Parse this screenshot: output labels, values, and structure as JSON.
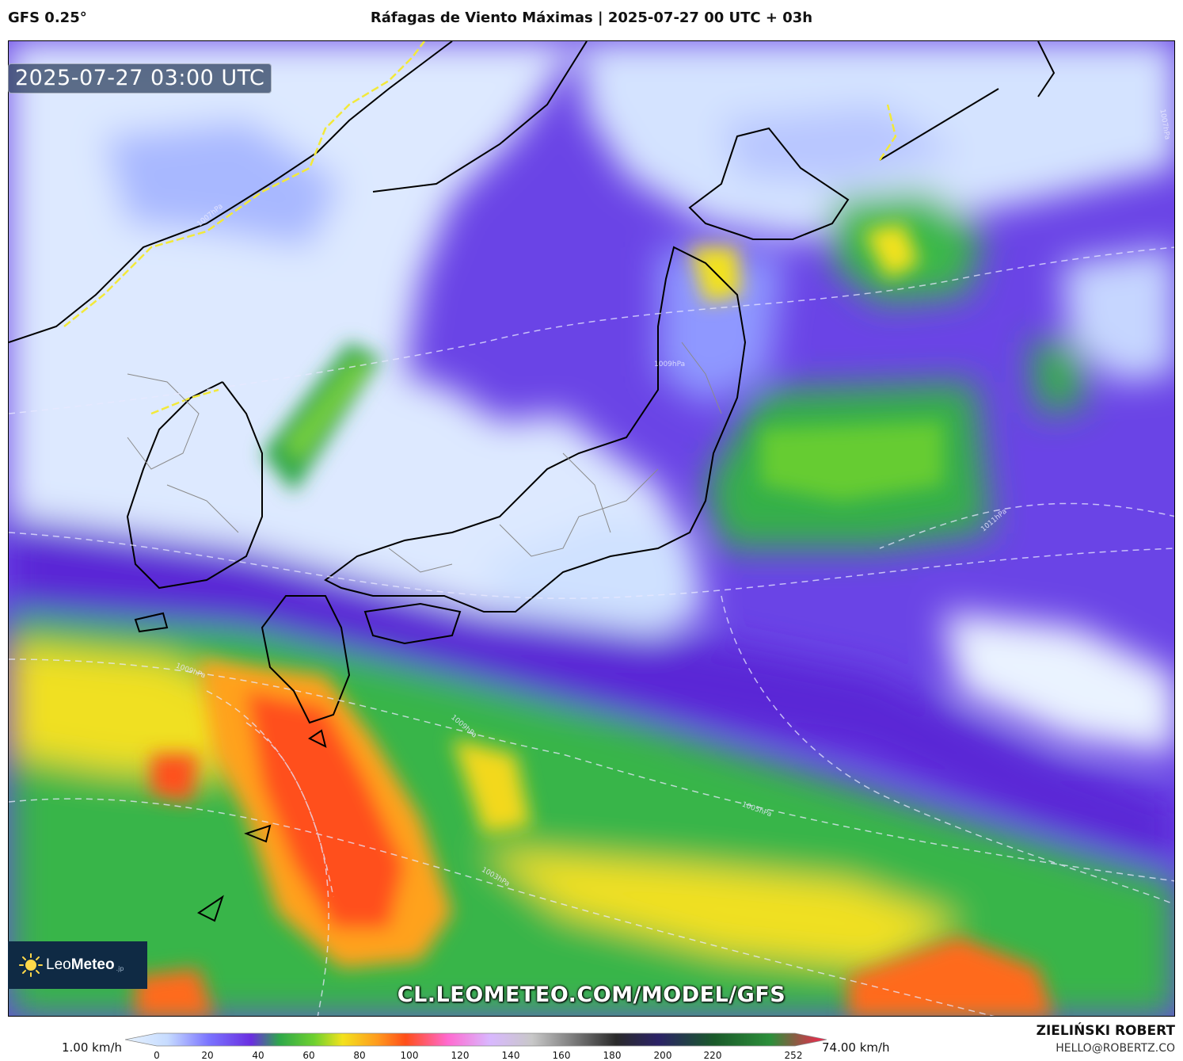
{
  "header": {
    "model": "GFS 0.25°",
    "title": "Ráfagas de Viento Máximas | 2025-07-27 00 UTC + 03h"
  },
  "map": {
    "valid_time": "2025-07-27 03:00 UTC",
    "watermark": "CL.LEOMETEO.COM/MODEL/GFS",
    "isobar_labels": [
      "1007hPa",
      "1009hPa",
      "1011hPa",
      "1007hPa",
      "1009hPa",
      "1005hPa",
      "1003hPa",
      "1009hPa"
    ]
  },
  "logo": {
    "brand_light": "Leo",
    "brand_bold": "Meteo",
    "suffix": ".jp",
    "icon": "sun-icon"
  },
  "legend": {
    "min_label": "1.00 km/h",
    "max_label": "74.00 km/h",
    "ticks": [
      "0",
      "20",
      "40",
      "60",
      "80",
      "100",
      "120",
      "140",
      "160",
      "180",
      "200",
      "220",
      "252"
    ],
    "colors": [
      "#e6f2ff",
      "#c7dcff",
      "#7a73ff",
      "#6a2ee0",
      "#2ea84a",
      "#6fd12f",
      "#f3e21d",
      "#ff9a1e",
      "#ff4e1a",
      "#ff6ad0",
      "#d9b8ff",
      "#c8c8c8",
      "#7a7a7a",
      "#2a2a2a",
      "#2b2266",
      "#1a5a2a",
      "#2c8f3a",
      "#ff1f4f"
    ]
  },
  "credit": {
    "name": "ZIELIŃSKI ROBERT",
    "email": "HELLO@ROBERTZ.CO"
  }
}
